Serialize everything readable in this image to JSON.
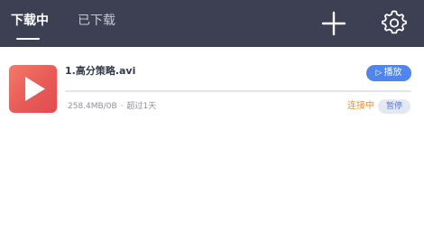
{
  "header": {
    "tabs": [
      {
        "label": "下载中",
        "active": true
      },
      {
        "label": "已下载",
        "active": false
      }
    ],
    "actions": {
      "add_icon": "plus-icon",
      "settings_icon": "gear-icon"
    }
  },
  "downloads": [
    {
      "filename": "1.高分策略.avi",
      "size_text": "258.4MB/0B",
      "separator": "·",
      "time_text": "超过1天",
      "progress": 0,
      "play_icon": "play-outline-icon",
      "play_label": "播放",
      "status": "连接中",
      "pause_label": "暂停"
    }
  ],
  "colors": {
    "header_bg": "#3d4052",
    "accent": "#4f86ee",
    "status": "#f0902d",
    "thumb_gradient": [
      "#f47a6a",
      "#e04d51"
    ]
  }
}
